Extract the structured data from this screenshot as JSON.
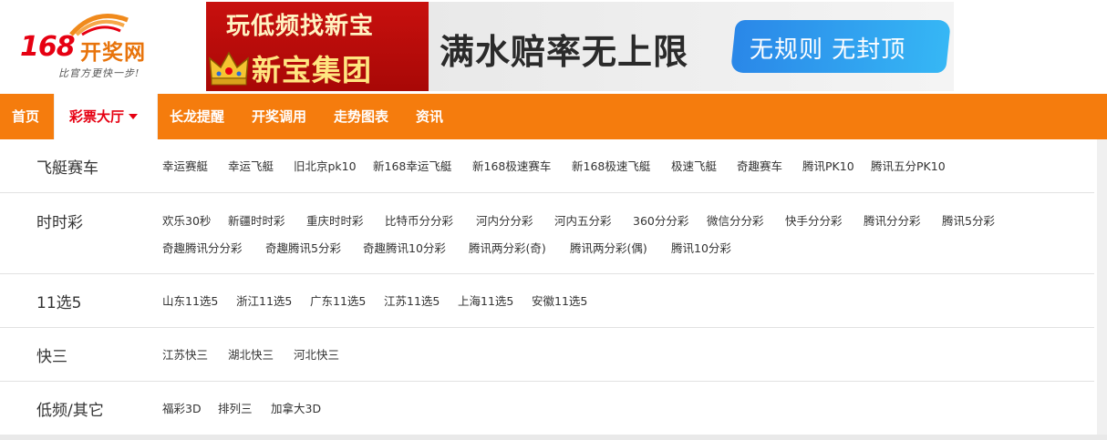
{
  "logo": {
    "number": "168",
    "name": "开奖网",
    "slogan": "比官方更快一步!"
  },
  "banner": {
    "line1": "玩低频找新宝",
    "line2": "新宝集团",
    "slogan": "满水赔率无上限",
    "pill": "无规则 无封顶"
  },
  "nav": {
    "items": [
      {
        "label": "首页"
      },
      {
        "label": "彩票大厅"
      },
      {
        "label": "长龙提醒"
      },
      {
        "label": "开奖调用"
      },
      {
        "label": "走势图表"
      },
      {
        "label": "资讯"
      }
    ],
    "active": "彩票大厅"
  },
  "categories": [
    {
      "title": "飞艇赛车",
      "games": [
        "幸运赛艇",
        "幸运飞艇",
        "旧北京pk10",
        "新168幸运飞艇",
        "新168极速赛车",
        "新168极速飞艇",
        "极速飞艇",
        "奇趣赛车",
        "腾讯PK10",
        "腾讯五分PK10"
      ]
    },
    {
      "title": "时时彩",
      "games": [
        "欢乐30秒",
        "新疆时时彩",
        "重庆时时彩",
        "比特币分分彩",
        "河内分分彩",
        "河内五分彩",
        "360分分彩",
        "微信分分彩",
        "快手分分彩",
        "腾讯分分彩",
        "腾讯5分彩",
        "奇趣腾讯分分彩",
        "奇趣腾讯5分彩",
        "奇趣腾讯10分彩",
        "腾讯两分彩(奇)",
        "腾讯两分彩(偶)",
        "腾讯10分彩"
      ]
    },
    {
      "title": "11选5",
      "games": [
        "山东11选5",
        "浙江11选5",
        "广东11选5",
        "江苏11选5",
        "上海11选5",
        "安徽11选5"
      ]
    },
    {
      "title": "快三",
      "games": [
        "江苏快三",
        "湖北快三",
        "河北快三"
      ]
    },
    {
      "title": "低频/其它",
      "games": [
        "福彩3D",
        "排列三",
        "加拿大3D"
      ]
    }
  ],
  "colors": {
    "nav_bg": "#f57c0d",
    "active_text": "#e60012",
    "logo_red": "#e60012",
    "logo_orange": "#e8740c"
  }
}
